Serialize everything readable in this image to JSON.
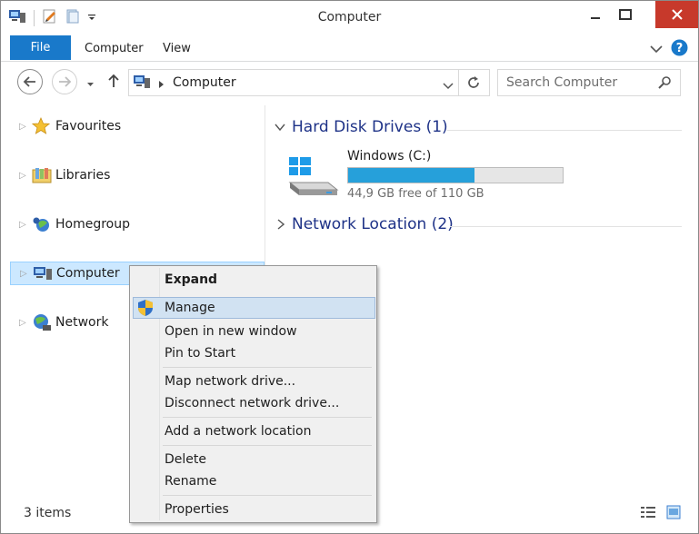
{
  "window": {
    "title": "Computer"
  },
  "ribbon": {
    "file_tab": "File",
    "tabs": [
      "Computer",
      "View"
    ]
  },
  "address": {
    "path": "Computer",
    "search_placeholder": "Search Computer"
  },
  "nav": {
    "items": [
      {
        "label": "Favourites",
        "icon": "star-icon"
      },
      {
        "label": "Libraries",
        "icon": "libraries-icon"
      },
      {
        "label": "Homegroup",
        "icon": "homegroup-icon"
      },
      {
        "label": "Computer",
        "icon": "computer-icon",
        "selected": true
      },
      {
        "label": "Network",
        "icon": "network-icon"
      }
    ]
  },
  "content": {
    "groups": [
      {
        "title": "Hard Disk Drives (1)",
        "expanded": true
      },
      {
        "title": "Network Location (2)",
        "expanded": false
      }
    ],
    "drive": {
      "name": "Windows (C:)",
      "free_text": "44,9 GB free of 110 GB",
      "used_fraction": 0.59,
      "bar_color": "#26a0da"
    }
  },
  "status": {
    "items": "3 items"
  },
  "context_menu": {
    "items": [
      {
        "label": "Expand",
        "bold": true
      },
      {
        "label": "Manage",
        "highlighted": true,
        "icon": "uac-shield-icon"
      },
      {
        "label": "Open in new window"
      },
      {
        "label": "Pin to Start"
      },
      {
        "label": "Map network drive..."
      },
      {
        "label": "Disconnect network drive..."
      },
      {
        "label": "Add a network location"
      },
      {
        "label": "Delete"
      },
      {
        "label": "Rename"
      },
      {
        "label": "Properties"
      }
    ]
  },
  "colors": {
    "accent": "#1979ca",
    "close": "#c7392b",
    "group_title": "#1e3287",
    "selection": "#cce8ff"
  }
}
